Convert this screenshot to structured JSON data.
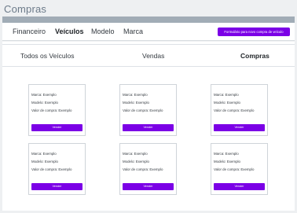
{
  "page": {
    "title": "Compras"
  },
  "nav": {
    "items": [
      "Financeiro",
      "Veículos",
      "Modelo",
      "Marca"
    ],
    "active": "Veículos",
    "new_purchase_label": "Formulário para novo compra de veículo"
  },
  "tabs": {
    "items": [
      "Todos os Veículos",
      "Vendas",
      "Compras"
    ],
    "active": "Compras"
  },
  "cards": [
    {
      "brand": "Marca: Exemplo",
      "model": "Modelo: Exemplo",
      "price": "Valor de compra: Exemplo",
      "button": "Vender"
    },
    {
      "brand": "Marca: Exemplo",
      "model": "Modelo: Exemplo",
      "price": "Valor de compra: Exemplo",
      "button": "Vender"
    },
    {
      "brand": "Marca: Exemplo",
      "model": "Modelo: Exemplo",
      "price": "Valor de compra: Exemplo",
      "button": "Vender"
    },
    {
      "brand": "Marca: Exemplo",
      "model": "Modelo: Exemplo",
      "price": "Valor de compra: Exemplo",
      "button": "Vender"
    },
    {
      "brand": "Marca: Exemplo",
      "model": "Modelo: Exemplo",
      "price": "Valor de compra: Exemplo",
      "button": "Vender"
    },
    {
      "brand": "Marca: Exemplo",
      "model": "Modelo: Exemplo",
      "price": "Valor de compra: Exemplo",
      "button": "Vender"
    }
  ],
  "colors": {
    "accent": "#7b00e6",
    "header_strip": "#a1acb6",
    "title": "#6c7a89",
    "background": "#eef0f2"
  }
}
